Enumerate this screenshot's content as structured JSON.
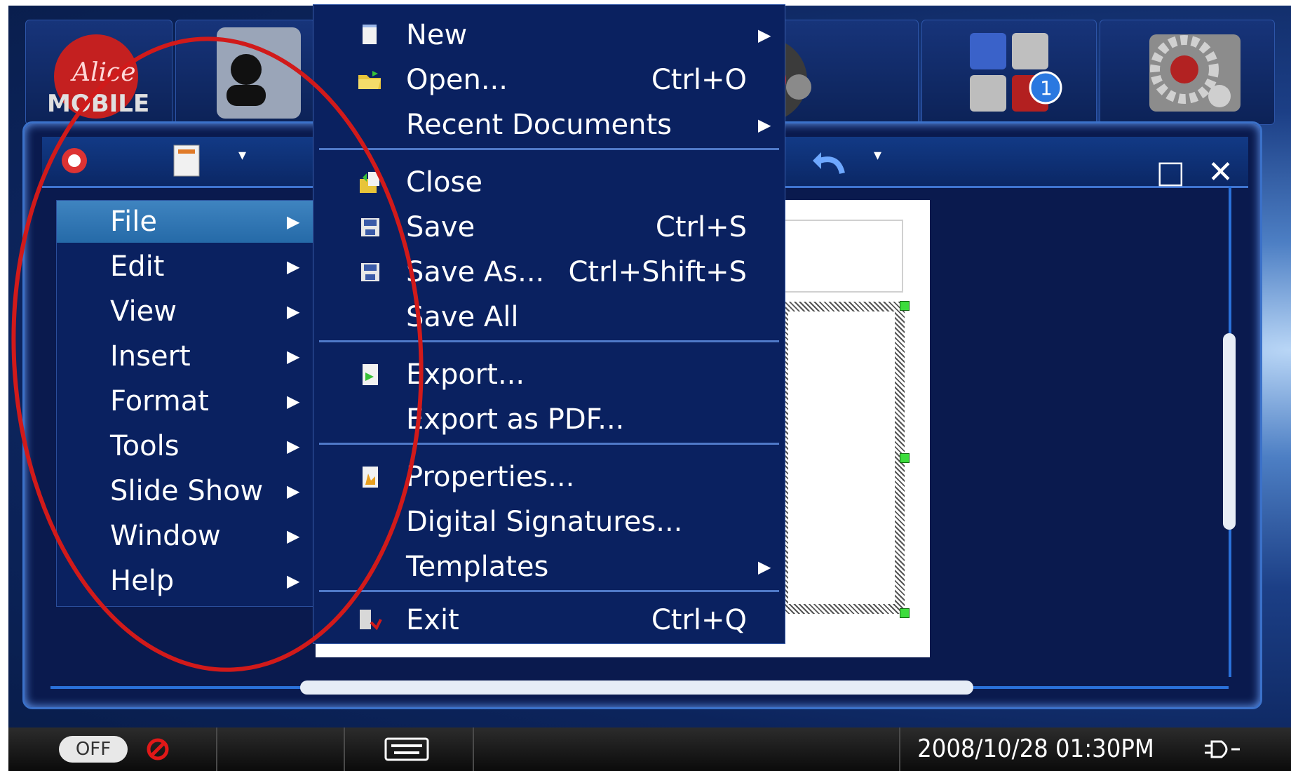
{
  "launcher": {
    "tiles": [
      "alice-mobile-logo",
      "contacts-icon",
      "media-player-icon",
      "apps-icon",
      "settings-icon"
    ],
    "logo_line1": "Alice",
    "logo_line2": "MOBILE",
    "apps_badge": "1"
  },
  "window_controls": {
    "maximize": "□",
    "close": "✕"
  },
  "main_menu": {
    "items": [
      {
        "label": "File",
        "arrow": "▶",
        "selected": true
      },
      {
        "label": "Edit",
        "arrow": "▶"
      },
      {
        "label": "View",
        "arrow": "▶"
      },
      {
        "label": "Insert",
        "arrow": "▶"
      },
      {
        "label": "Format",
        "arrow": "▶"
      },
      {
        "label": "Tools",
        "arrow": "▶"
      },
      {
        "label": "Slide Show",
        "arrow": "▶"
      },
      {
        "label": "Window",
        "arrow": "▶"
      },
      {
        "label": "Help",
        "arrow": "▶"
      }
    ]
  },
  "file_menu": {
    "items": [
      {
        "label": "New",
        "shortcut": "",
        "arrow": "▶",
        "icon": "new-document-icon"
      },
      {
        "label": "Open...",
        "shortcut": "Ctrl+O",
        "arrow": "",
        "icon": "open-folder-icon"
      },
      {
        "label": "Recent Documents",
        "shortcut": "",
        "arrow": "▶",
        "icon": ""
      },
      {
        "label": "Close",
        "shortcut": "",
        "arrow": "",
        "icon": "close-document-icon"
      },
      {
        "label": "Save",
        "shortcut": "Ctrl+S",
        "arrow": "",
        "icon": "save-icon"
      },
      {
        "label": "Save As...",
        "shortcut": "Ctrl+Shift+S",
        "arrow": "",
        "icon": "save-as-icon"
      },
      {
        "label": "Save All",
        "shortcut": "",
        "arrow": "",
        "icon": ""
      },
      {
        "label": "Export...",
        "shortcut": "",
        "arrow": "",
        "icon": "export-icon"
      },
      {
        "label": "Export as PDF...",
        "shortcut": "",
        "arrow": "",
        "icon": ""
      },
      {
        "label": "Properties...",
        "shortcut": "",
        "arrow": "",
        "icon": "properties-icon"
      },
      {
        "label": "Digital Signatures...",
        "shortcut": "",
        "arrow": "",
        "icon": ""
      },
      {
        "label": "Templates",
        "shortcut": "",
        "arrow": "▶",
        "icon": ""
      },
      {
        "label": "Exit",
        "shortcut": "Ctrl+Q",
        "arrow": "",
        "icon": "exit-icon"
      }
    ]
  },
  "taskbar": {
    "toggle_label": "OFF",
    "datetime": "2008/10/28 01:30PM"
  },
  "colors": {
    "menu_bg": "#0a2160",
    "selected_item": "#2f76b4",
    "annotation_oval": "#d11a1a"
  }
}
